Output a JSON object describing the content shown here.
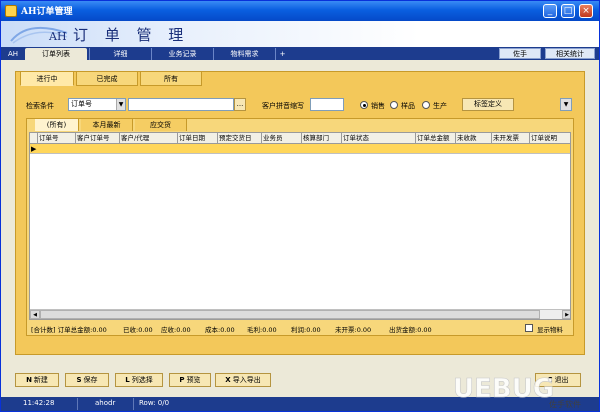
{
  "window": {
    "title": "AH订单管理",
    "min": "_",
    "max": "□",
    "close": "×"
  },
  "banner": {
    "prefix": "AH",
    "title": "订 单 管 理"
  },
  "menu": {
    "app": "AH",
    "tabs": [
      "订单列表",
      "详细",
      "业务记录",
      "物料需求",
      "+"
    ],
    "right": [
      "佐手",
      "相关统计"
    ]
  },
  "status_tabs": [
    "进行中",
    "已完成",
    "所有"
  ],
  "search": {
    "label": "检索条件",
    "field": "订单号",
    "browse": "...",
    "pinyin_label": "客户拼音缩写",
    "radios": [
      "销售",
      "样品",
      "生产"
    ],
    "tag_button": "标签定义"
  },
  "grid_tabs": [
    "(所有)",
    "本月最新",
    "应交货"
  ],
  "columns": [
    "订单号",
    "客户订单号",
    "客户/代理",
    "订单日期",
    "预定交货日",
    "业务员",
    "核算部门",
    "订单状态",
    "订单总金额",
    "未收款",
    "未开发票",
    "订单说明"
  ],
  "summary": {
    "items": [
      "[合计数] 订单总金额:0.00",
      "已收:0.00",
      "应收:0.00",
      "成本:0.00",
      "毛利:0.00",
      "利润:0.00",
      "未开票:0.00",
      "出货金额:0.00"
    ],
    "checkbox": "显示物料"
  },
  "buttons": [
    {
      "key": "N",
      "label": "新建"
    },
    {
      "key": "S",
      "label": "保存"
    },
    {
      "key": "L",
      "label": "列选择"
    },
    {
      "key": "P",
      "label": "预览"
    },
    {
      "key": "X",
      "label": "导入导出"
    },
    {
      "key": "C",
      "label": "退出"
    }
  ],
  "statusbar": {
    "time": "11:42:28",
    "user": "ahodr",
    "rows": "Row: 0/0"
  },
  "watermark": {
    "brand": "UEBUG",
    "sub": "佐手软件"
  },
  "colors": {
    "accent": "#1d3c8e",
    "panel": "#f3c85a",
    "selected_row": "#ffd65a"
  }
}
